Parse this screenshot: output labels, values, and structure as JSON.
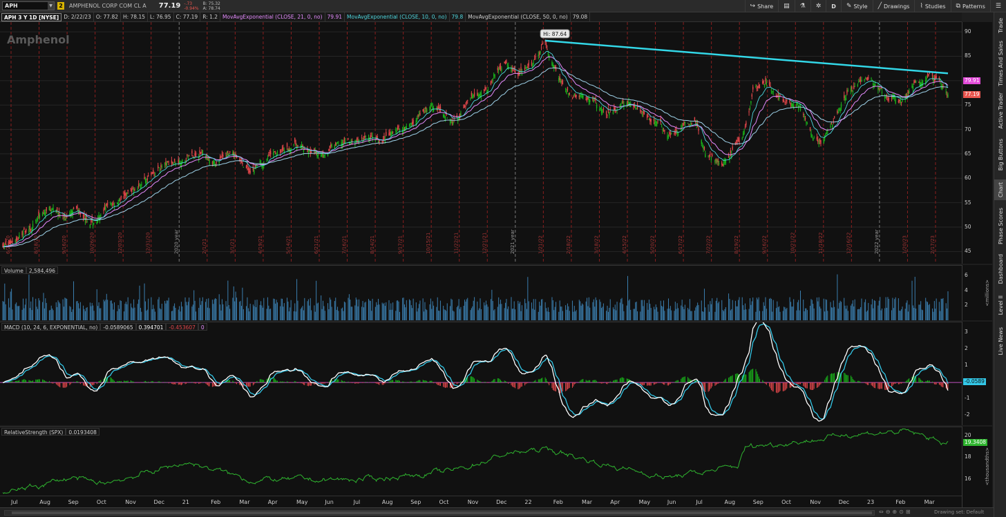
{
  "toolbar": {
    "symbol": "APH",
    "link_badge": "2",
    "company": "AMPHENOL CORP COM CL A",
    "last": "77.19",
    "change": "-.73",
    "change_pct": "-0.94%",
    "bid": "B: 75.32",
    "ask": "A: 78.74",
    "buttons": {
      "share": "Share",
      "period": "D",
      "style": "Style",
      "drawings": "Drawings",
      "studies": "Studies",
      "patterns": "Patterns"
    }
  },
  "info": {
    "title": "APH 3 Y 1D [NYSE]",
    "date": "D: 2/22/23",
    "open": "O: 77.82",
    "high": "H: 78.15",
    "low": "L: 76.95",
    "close": "C: 77.19",
    "range": "R: 1.2",
    "ma21_label": "MovAvgExponential (CLOSE, 21, 0, no)",
    "ma21_value": "79.91",
    "ma10_label": "MovAvgExponential (CLOSE, 10, 0, no)",
    "ma10_value": "79.8",
    "ma50_label": "MovAvgExponential (CLOSE, 50, 0, no)",
    "ma50_value": "79.08"
  },
  "watermark": "Amphenol",
  "hi_label": "Hi: 87.64",
  "price_axis": {
    "ticks": [
      "90",
      "85",
      "80",
      "75",
      "70",
      "65",
      "60",
      "55",
      "50",
      "45"
    ],
    "flag_ma": "79.91",
    "flag_last": "77.19",
    "ma_color": "#e24ad8",
    "last_color": "#e8554e"
  },
  "volume": {
    "label": "Volume",
    "value": "2,584,496",
    "ticks": [
      "6",
      "4",
      "2"
    ],
    "unit": "<millions>",
    "color": "#3b7fb0"
  },
  "macd": {
    "label": "MACD (10, 24, 6, EXPONENTIAL, no)",
    "value": "-0.0589065",
    "avg": "0.394701",
    "diff": "-0.453607",
    "zero": "0",
    "ticks": [
      "3",
      "2",
      "1",
      "-1",
      "-2"
    ],
    "flag": "-0.0589"
  },
  "rs": {
    "label": "RelativeStrength (SPX)",
    "value": "0.0193408",
    "ticks": [
      "20",
      "18",
      "16"
    ],
    "unit": "<thousandths>",
    "flag": "19.3408"
  },
  "x_axis": {
    "labels": [
      "Jul",
      "Aug",
      "Sep",
      "Oct",
      "Nov",
      "Dec",
      "21",
      "Feb",
      "Mar",
      "Apr",
      "May",
      "Jun",
      "Jul",
      "Aug",
      "Sep",
      "Oct",
      "Nov",
      "Dec",
      "22",
      "Feb",
      "Mar",
      "Apr",
      "May",
      "Jun",
      "Jul",
      "Aug",
      "Sep",
      "Oct",
      "Nov",
      "Dec",
      "23",
      "Feb",
      "Mar"
    ]
  },
  "event_dates": [
    "6/23/20",
    "8/18/20",
    "9/16/20",
    "10/26/20",
    "12/03/20",
    "12/31/20",
    "2020 year",
    "2/1/21",
    "3/1/21",
    "4/19/21",
    "5/14/21",
    "6/21/21",
    "7/16/21",
    "8/14/21",
    "9/17/21",
    "10/15/21",
    "11/22/21",
    "12/21/21",
    "2021 year",
    "1/21/22",
    "2/18/22",
    "3/18/22",
    "4/15/22",
    "5/20/22",
    "6/17/22",
    "7/22/22",
    "8/19/22",
    "9/16/22",
    "10/21/22",
    "11/18/22",
    "12/16/22",
    "2022 year",
    "1/20/23",
    "2/17/23"
  ],
  "right_tabs": [
    "Trade",
    "Times And Sales",
    "Active Trader",
    "Big Buttons",
    "Chart",
    "Phase Scores",
    "Dashboard",
    "Level II",
    "Live News"
  ],
  "bottom": {
    "drawing_set": "Drawing set: Default"
  },
  "colors": {
    "up": "#19b31a",
    "down": "#e0464a",
    "trendline": "#33d8e8",
    "ma10": "#4fd8e0",
    "ma21": "#e68cff",
    "ma50": "#9fd3ea",
    "macd_line": "#ffffff",
    "macd_avg": "#33c8e8",
    "rs_line": "#2fb52f"
  },
  "chart_data": {
    "type": "candlestick",
    "title": "APH 3 Y 1D [NYSE]",
    "ylim": [
      42.5,
      92
    ],
    "yticks": [
      45,
      50,
      55,
      60,
      65,
      70,
      75,
      80,
      85,
      90
    ],
    "hi": 87.64,
    "last": 77.19,
    "price_keypoints": [
      [
        "2020-06-29",
        46.5
      ],
      [
        "2020-07-20",
        50
      ],
      [
        "2020-08-10",
        53.5
      ],
      [
        "2020-08-25",
        52
      ],
      [
        "2020-09-10",
        53.5
      ],
      [
        "2020-09-25",
        51
      ],
      [
        "2020-10-20",
        55.5
      ],
      [
        "2020-11-09",
        58
      ],
      [
        "2020-11-30",
        62
      ],
      [
        "2020-12-25",
        64
      ],
      [
        "2021-01-15",
        65.5
      ],
      [
        "2021-01-29",
        63
      ],
      [
        "2021-02-15",
        65.5
      ],
      [
        "2021-03-05",
        61.5
      ],
      [
        "2021-03-20",
        64
      ],
      [
        "2021-04-20",
        66.5
      ],
      [
        "2021-05-12",
        65
      ],
      [
        "2021-06-15",
        67.5
      ],
      [
        "2021-07-20",
        68
      ],
      [
        "2021-08-20",
        71.5
      ],
      [
        "2021-09-10",
        74.5
      ],
      [
        "2021-09-28",
        72.5
      ],
      [
        "2021-10-20",
        76
      ],
      [
        "2021-11-05",
        79
      ],
      [
        "2021-11-22",
        84
      ],
      [
        "2021-12-05",
        81
      ],
      [
        "2021-12-20",
        83
      ],
      [
        "2022-01-03",
        87.2
      ],
      [
        "2022-01-18",
        80
      ],
      [
        "2022-01-30",
        77
      ],
      [
        "2022-02-20",
        75.5
      ],
      [
        "2022-03-08",
        73
      ],
      [
        "2022-03-29",
        76.5
      ],
      [
        "2022-04-25",
        72
      ],
      [
        "2022-05-12",
        69
      ],
      [
        "2022-06-06",
        72
      ],
      [
        "2022-06-17",
        65
      ],
      [
        "2022-07-05",
        63.5
      ],
      [
        "2022-07-25",
        68
      ],
      [
        "2022-08-05",
        78
      ],
      [
        "2022-08-20",
        79.5
      ],
      [
        "2022-09-06",
        74.5
      ],
      [
        "2022-09-20",
        75.5
      ],
      [
        "2022-10-05",
        67.5
      ],
      [
        "2022-10-14",
        67
      ],
      [
        "2022-10-28",
        72
      ],
      [
        "2022-11-14",
        78.5
      ],
      [
        "2022-12-05",
        80.5
      ],
      [
        "2022-12-20",
        76
      ],
      [
        "2023-01-05",
        75.5
      ],
      [
        "2023-01-20",
        79.5
      ],
      [
        "2023-02-03",
        81
      ],
      [
        "2023-02-14",
        80
      ],
      [
        "2023-02-22",
        77.19
      ]
    ],
    "trendline": [
      [
        "2022-01-03",
        88.2
      ],
      [
        "2023-02-22",
        81.5
      ]
    ],
    "volume_ylim": [
      0,
      7
    ],
    "macd_ylim": [
      -2.6,
      3.6
    ],
    "rs_ylim": [
      14.5,
      20.8
    ],
    "rs_keypoints": [
      [
        "2020-06-29",
        14.8
      ],
      [
        "2020-09-01",
        16.2
      ],
      [
        "2020-10-01",
        15.6
      ],
      [
        "2020-12-31",
        17.6
      ],
      [
        "2021-03-05",
        16.0
      ],
      [
        "2021-06-30",
        16.0
      ],
      [
        "2021-09-30",
        16.8
      ],
      [
        "2021-11-25",
        18.4
      ],
      [
        "2022-01-05",
        18.8
      ],
      [
        "2022-02-28",
        17.5
      ],
      [
        "2022-05-10",
        16.2
      ],
      [
        "2022-07-20",
        17.2
      ],
      [
        "2022-07-28",
        19.0
      ],
      [
        "2022-10-20",
        19.8
      ],
      [
        "2022-11-10",
        20.2
      ],
      [
        "2023-01-10",
        20.4
      ],
      [
        "2023-02-22",
        19.34
      ]
    ]
  }
}
